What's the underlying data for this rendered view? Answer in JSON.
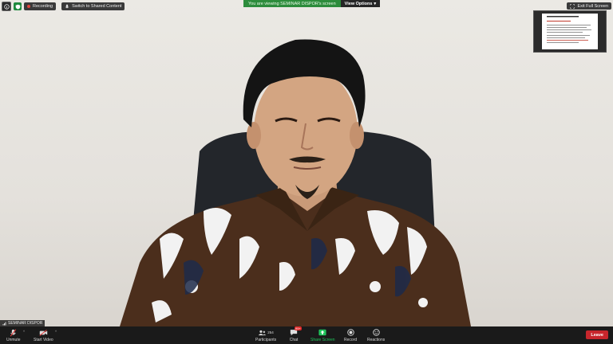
{
  "top_bar": {
    "recording_label": "Recording",
    "switch_label": "Switch to Shared Content"
  },
  "share_banner": {
    "text": "You are viewing SEMINAR DISPOR's screen",
    "view_options_label": "View Options"
  },
  "exit_fullscreen_label": "Exit Full Screen",
  "video": {
    "participant_name": "SEMINAR DISPOR"
  },
  "toolbar": {
    "unmute_label": "Unmute",
    "start_video_label": "Start Video",
    "participants_label": "Participants",
    "participants_count": "254",
    "chat_label": "Chat",
    "chat_badge": "99+",
    "share_screen_label": "Share Screen",
    "record_label": "Record",
    "reactions_label": "Reactions",
    "leave_label": "Leave"
  },
  "colors": {
    "banner_green": "#2d8c3c",
    "share_green": "#1fc35a",
    "leave_red": "#c7262c"
  }
}
